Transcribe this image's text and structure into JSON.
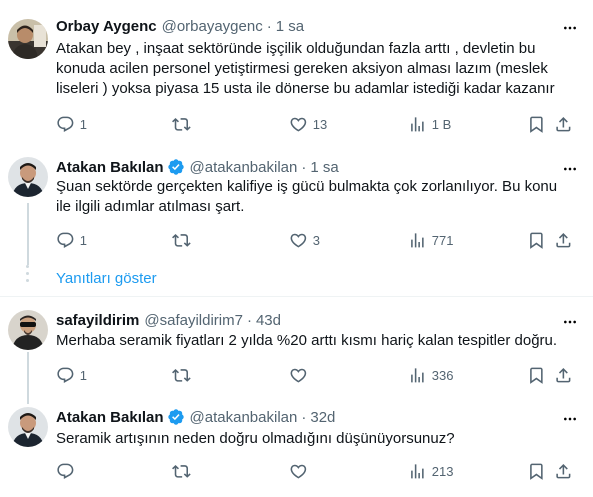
{
  "tweets": [
    {
      "name": "Orbay Aygenc",
      "handle": "@orbayaygenc",
      "dot": "·",
      "time": "1 sa",
      "lines": [
        "Atakan bey , inşaat sektöründe işçilik olduğundan fazla arttı , devletin bu",
        "konuda acilen personel yetiştirmesi gereken aksiyon alması lazım (meslek",
        "liseleri ) yoksa piyasa 15 usta ile dönerse bu adamlar istediği kadar kazanır"
      ],
      "replies": "1",
      "retweets": "",
      "likes": "13",
      "views": "1 B",
      "verified": false
    },
    {
      "name": "Atakan Bakılan",
      "handle": "@atakanbakilan",
      "dot": "·",
      "time": "1 sa",
      "lines": [
        "Şuan sektörde gerçekten kalifiye iş gücü bulmakta çok zorlanılıyor. Bu konu",
        "ile ilgili adımlar atılması şart."
      ],
      "replies": "1",
      "retweets": "",
      "likes": "3",
      "views": "771",
      "verified": true
    },
    {
      "name": "safayildirim",
      "handle": "@safayildirim7",
      "dot": "·",
      "time": "43d",
      "lines": [
        "Merhaba seramik fiyatları 2 yılda %20 arttı kısmı hariç kalan tespitler doğru."
      ],
      "replies": "1",
      "retweets": "",
      "likes": "",
      "views": "336",
      "verified": false
    },
    {
      "name": "Atakan Bakılan",
      "handle": "@atakanbakilan",
      "dot": "·",
      "time": "32d",
      "lines": [
        "Seramik artışının neden doğru olmadığını düşünüyorsunuz?"
      ],
      "replies": "",
      "retweets": "",
      "likes": "",
      "views": "213",
      "verified": true
    }
  ],
  "show_replies": "Yanıtları göster",
  "colors": {
    "accent": "#1d9bf0",
    "secondary_text": "#536471",
    "divider": "#eff3f4",
    "thread_line": "#cfd9de"
  },
  "icons": [
    "reply-icon",
    "retweet-icon",
    "like-icon",
    "views-icon",
    "bookmark-icon",
    "share-icon",
    "more-icon",
    "verified-badge-icon"
  ]
}
